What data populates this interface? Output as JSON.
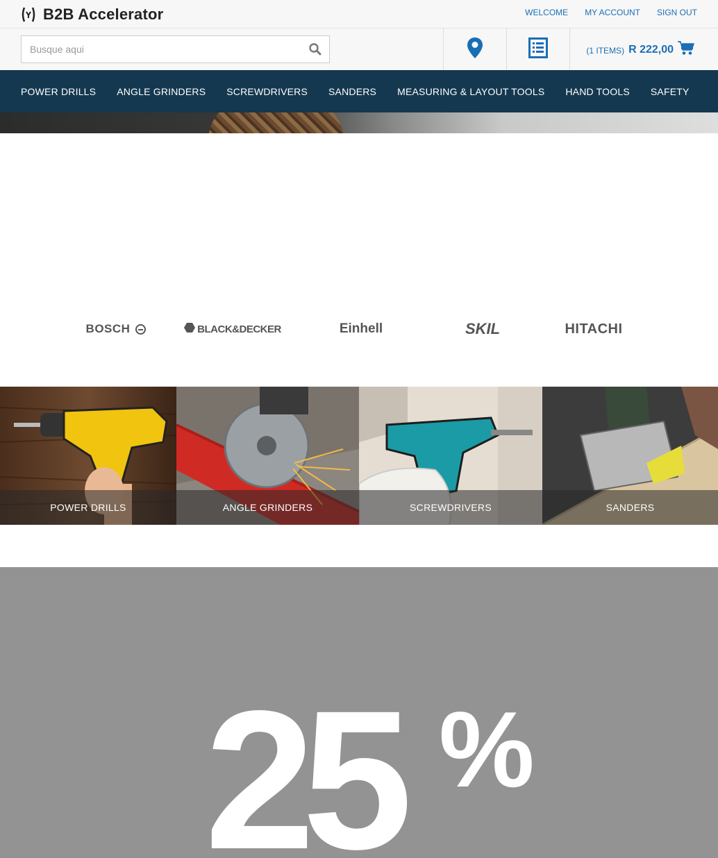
{
  "header": {
    "logo_text": "B2B Accelerator",
    "links": {
      "welcome": "WELCOME",
      "my_account": "MY ACCOUNT",
      "sign_out": "SIGN OUT"
    }
  },
  "search": {
    "placeholder": "Busque aqui",
    "value": ""
  },
  "cart": {
    "items_label": "(1 ITEMS)",
    "total": "R 222,00"
  },
  "nav": {
    "items": [
      "POWER DRILLS",
      "ANGLE GRINDERS",
      "SCREWDRIVERS",
      "SANDERS",
      "MEASURING & LAYOUT TOOLS",
      "HAND TOOLS",
      "SAFETY"
    ]
  },
  "brands": {
    "bosch": "BOSCH",
    "black_decker": "BLACK&DECKER",
    "einhell": "Einhell",
    "skil": "SKIL",
    "hitachi": "HITACHI"
  },
  "categories": [
    "POWER DRILLS",
    "ANGLE GRINDERS",
    "SCREWDRIVERS",
    "SANDERS"
  ],
  "promo": {
    "number": "25",
    "percent": "%"
  },
  "colors": {
    "accent": "#1a6eb5",
    "nav_bg": "#14384f",
    "promo_bg": "#939393"
  }
}
